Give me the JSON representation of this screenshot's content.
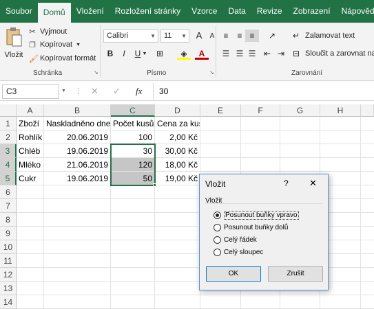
{
  "tabs": [
    "Soubor",
    "Domů",
    "Vložení",
    "Rozložení stránky",
    "Vzorce",
    "Data",
    "Revize",
    "Zobrazení",
    "Nápověda"
  ],
  "ribbon": {
    "paste": "Vložit",
    "cut": "Vyjmout",
    "copy": "Kopírovat",
    "format_painter": "Kopírovat formát",
    "clipboard_group": "Schránka",
    "font_name": "Calibri",
    "font_size": "11",
    "font_group": "Písmo",
    "wrap_text": "Zalamovat text",
    "merge_center": "Sloučit a zarovnat na",
    "alignment_group": "Zarovnání",
    "bold": "B",
    "italic": "I",
    "underline": "U",
    "grow_font": "A",
    "shrink_font": "A",
    "font_color_letter": "A"
  },
  "formula_bar": {
    "name_box": "C3",
    "fx": "fx",
    "value": "30"
  },
  "columns": [
    "A",
    "B",
    "C",
    "D",
    "E",
    "F",
    "G",
    "H"
  ],
  "rows": [
    "1",
    "2",
    "3",
    "4",
    "5",
    "6",
    "7",
    "8",
    "9",
    "10",
    "11",
    "12",
    "13",
    "14"
  ],
  "table": {
    "headers": [
      "Zboží",
      "Naskladněno dne",
      "Počet kusů",
      "Cena za kus"
    ],
    "data": [
      [
        "Rohlík",
        "20.06.2019",
        "100",
        "2,00 Kč"
      ],
      [
        "Chléb",
        "19.06.2019",
        "30",
        "30,00 Kč"
      ],
      [
        "Mléko",
        "21.06.2019",
        "120",
        "18,00 Kč"
      ],
      [
        "Cukr",
        "19.06.2019",
        "50",
        "19,00 Kč"
      ]
    ]
  },
  "dialog": {
    "title": "Vložit",
    "help": "?",
    "close": "✕",
    "group_label": "Vložit",
    "options": [
      "Posunout buňky vpravo",
      "Posunout buňky dolů",
      "Celý řádek",
      "Celý sloupec"
    ],
    "selected_index": 0,
    "ok": "OK",
    "cancel": "Zrušit"
  },
  "colors": {
    "brand": "#217346",
    "selection": "#c6c6c6"
  }
}
